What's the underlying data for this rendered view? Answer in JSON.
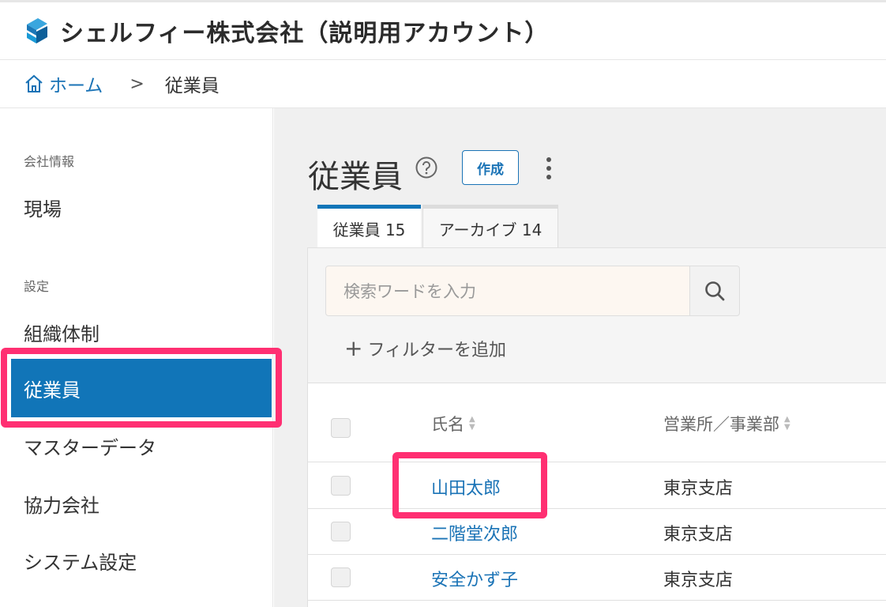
{
  "header": {
    "company_name": "シェルフィー株式会社（説明用アカウント）",
    "logo_icon": "stacked-s-logo",
    "brand_colors": [
      "#1a9ad6",
      "#0d5f99"
    ]
  },
  "breadcrumb": {
    "home_label": "ホーム",
    "separator": ">",
    "current": "従業員"
  },
  "sidebar": {
    "section_company": "会社情報",
    "item_site": "現場",
    "section_settings": "設定",
    "item_org": "組織体制",
    "item_employees": "従業員",
    "item_master": "マスターデータ",
    "item_partners": "協力会社",
    "item_system": "システム設定",
    "active_color": "#1175b8"
  },
  "main": {
    "title": "従業員",
    "create_label": "作成",
    "tabs": [
      {
        "label": "従業員 15"
      },
      {
        "label": "アーカイブ 14"
      }
    ],
    "search_placeholder": "検索ワードを入力",
    "add_filter_label": "フィルターを追加",
    "table": {
      "columns": [
        "氏名",
        "営業所／事業部"
      ],
      "rows": [
        {
          "name": "山田太郎",
          "office": "東京支店"
        },
        {
          "name": "二階堂次郎",
          "office": "東京支店"
        },
        {
          "name": "安全かず子",
          "office": "東京支店"
        }
      ]
    }
  },
  "highlight_color": "#ff2f72"
}
